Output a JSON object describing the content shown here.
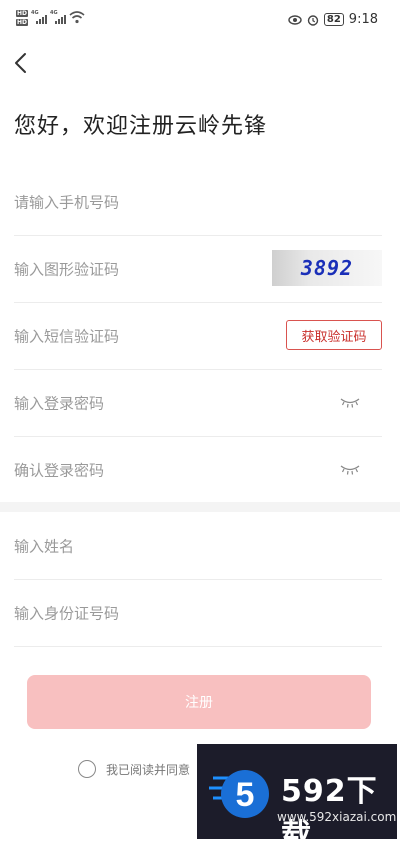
{
  "status_bar": {
    "hd_label": "HD",
    "network_label": "4G",
    "battery": "82",
    "time": "9:18"
  },
  "page": {
    "title": "您好，欢迎注册云岭先锋"
  },
  "form": {
    "phone_placeholder": "请输入手机号码",
    "captcha_placeholder": "输入图形验证码",
    "captcha_code": "3892",
    "sms_placeholder": "输入短信验证码",
    "sms_button": "获取验证码",
    "password_placeholder": "输入登录密码",
    "confirm_password_placeholder": "确认登录密码",
    "name_placeholder": "输入姓名",
    "id_placeholder": "输入身份证号码",
    "submit_button": "注册",
    "agree_text": "我已阅读并同意"
  },
  "watermark": {
    "logo_digit": "5",
    "title": "592下载",
    "url": "www.592xiazai.com"
  },
  "icons": {
    "back": "chevron-left-icon",
    "eye": "eye-closed-icon",
    "wifi": "wifi-icon",
    "alarm": "alarm-icon"
  },
  "colors": {
    "submit_bg": "#f8c0c0",
    "sms_border": "#d9534f",
    "captcha_text": "#1a2fb8"
  }
}
